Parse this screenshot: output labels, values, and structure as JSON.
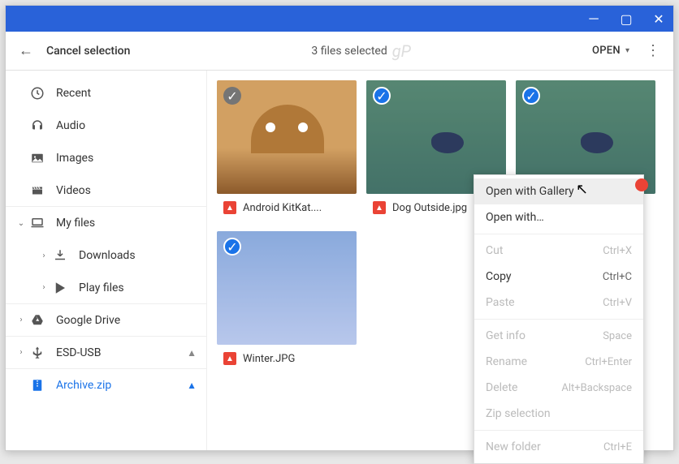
{
  "window": {
    "title": "Cancel selection",
    "count": "3 files selected",
    "open_label": "OPEN"
  },
  "sidebar": {
    "items": [
      {
        "label": "Recent",
        "icon": "clock"
      },
      {
        "label": "Audio",
        "icon": "headphones"
      },
      {
        "label": "Images",
        "icon": "image"
      },
      {
        "label": "Videos",
        "icon": "clapper"
      },
      {
        "label": "My files",
        "icon": "laptop",
        "expand": true
      },
      {
        "label": "Downloads",
        "icon": "download",
        "indent": 1,
        "expand": true
      },
      {
        "label": "Play files",
        "icon": "play",
        "indent": 1,
        "expand": true
      },
      {
        "label": "Google Drive",
        "icon": "drive",
        "expand": true
      },
      {
        "label": "ESD-USB",
        "icon": "usb",
        "expand": true,
        "eject": true
      },
      {
        "label": "Archive.zip",
        "icon": "zip",
        "eject": true,
        "active": true
      }
    ]
  },
  "files": [
    {
      "name": "Android KitKat....",
      "selected": false,
      "thumb": "android"
    },
    {
      "name": "Dog Outside.jpg",
      "selected": true,
      "thumb": "grass"
    },
    {
      "name": "",
      "selected": true,
      "thumb": "grass"
    },
    {
      "name": "Winter.JPG",
      "selected": true,
      "thumb": "winter"
    }
  ],
  "context_menu": {
    "items": [
      {
        "label": "Open with Gallery",
        "enabled": true,
        "highlight": true,
        "badge": true
      },
      {
        "label": "Open with…",
        "enabled": true
      },
      {
        "sep": true
      },
      {
        "label": "Cut",
        "shortcut": "Ctrl+X",
        "enabled": false
      },
      {
        "label": "Copy",
        "shortcut": "Ctrl+C",
        "enabled": true
      },
      {
        "label": "Paste",
        "shortcut": "Ctrl+V",
        "enabled": false
      },
      {
        "sep": true
      },
      {
        "label": "Get info",
        "shortcut": "Space",
        "enabled": false
      },
      {
        "label": "Rename",
        "shortcut": "Ctrl+Enter",
        "enabled": false
      },
      {
        "label": "Delete",
        "shortcut": "Alt+Backspace",
        "enabled": false
      },
      {
        "label": "Zip selection",
        "enabled": false
      },
      {
        "sep": true
      },
      {
        "label": "New folder",
        "shortcut": "Ctrl+E",
        "enabled": false
      }
    ]
  }
}
